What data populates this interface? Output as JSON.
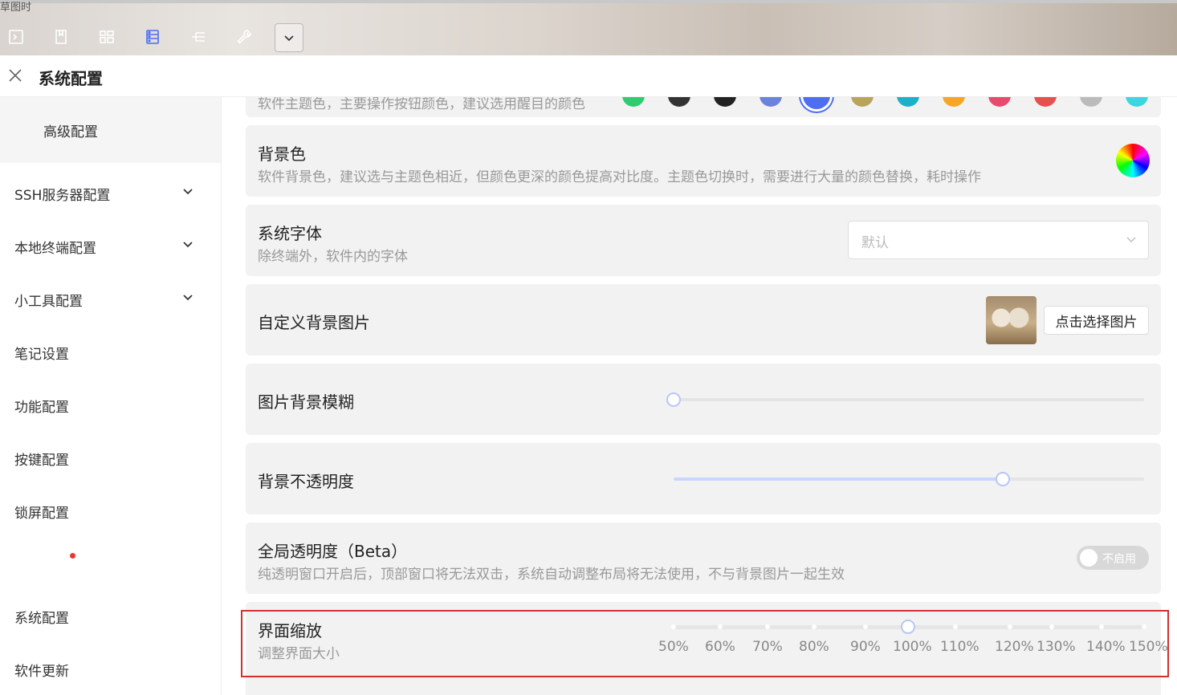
{
  "window": {
    "corner_text": "草图时",
    "title": "系统配置"
  },
  "toolbar": {
    "icons": [
      "terminal-icon",
      "note-icon",
      "grid-icon",
      "server-icon",
      "tree-icon",
      "wrench-icon",
      "chevron-down-icon"
    ],
    "active": "server-icon"
  },
  "sidebar": {
    "items": [
      {
        "label": "高级配置",
        "sub": true
      },
      {
        "label": "SSH服务器配置",
        "expandable": true
      },
      {
        "label": "本地终端配置",
        "expandable": true
      },
      {
        "label": "小工具配置",
        "expandable": true
      },
      {
        "label": "笔记设置"
      },
      {
        "label": "功能配置"
      },
      {
        "label": "按键配置"
      },
      {
        "label": "锁屏配置"
      },
      {
        "label": "系统配置"
      },
      {
        "label": "软件更新"
      }
    ],
    "notification_color": "#e53935"
  },
  "theme_color": {
    "desc": "软件主题色，主要操作按钮颜色，建议选用醒目的颜色",
    "swatches": [
      "#2ecc71",
      "#333333",
      "#222222",
      "#6b83d9",
      "#4e6ef2",
      "#b8a45a",
      "#1ab2c8",
      "#f5a623",
      "#e84a6f",
      "#e85050",
      "#bbbbbb",
      "#3dd6e0"
    ],
    "selected_index": 4
  },
  "background_color": {
    "label": "背景色",
    "desc": "软件背景色，建议选与主题色相近，但颜色更深的颜色提高对比度。主题色切换时，需要进行大量的颜色替换，耗时操作"
  },
  "system_font": {
    "label": "系统字体",
    "desc": "除终端外，软件内的字体",
    "placeholder": "默认"
  },
  "custom_bg_image": {
    "label": "自定义背景图片",
    "button": "点击选择图片"
  },
  "image_blur": {
    "label": "图片背景模糊",
    "value": 0
  },
  "bg_opacity": {
    "label": "背景不透明度",
    "value": 0.7
  },
  "global_transparency": {
    "label": "全局透明度（Beta）",
    "desc": "纯透明窗口开启后，顶部窗口将无法双击，系统自动调整布局将无法使用，不与背景图片一起生效",
    "toggle_text": "不启用",
    "enabled": false
  },
  "ui_scale": {
    "label": "界面缩放",
    "desc": "调整界面大小",
    "marks": [
      "50%",
      "60%",
      "70%",
      "80%",
      "90%",
      "100%",
      "110%",
      "120%",
      "130%",
      "140%",
      "150%"
    ],
    "value": "100%"
  }
}
